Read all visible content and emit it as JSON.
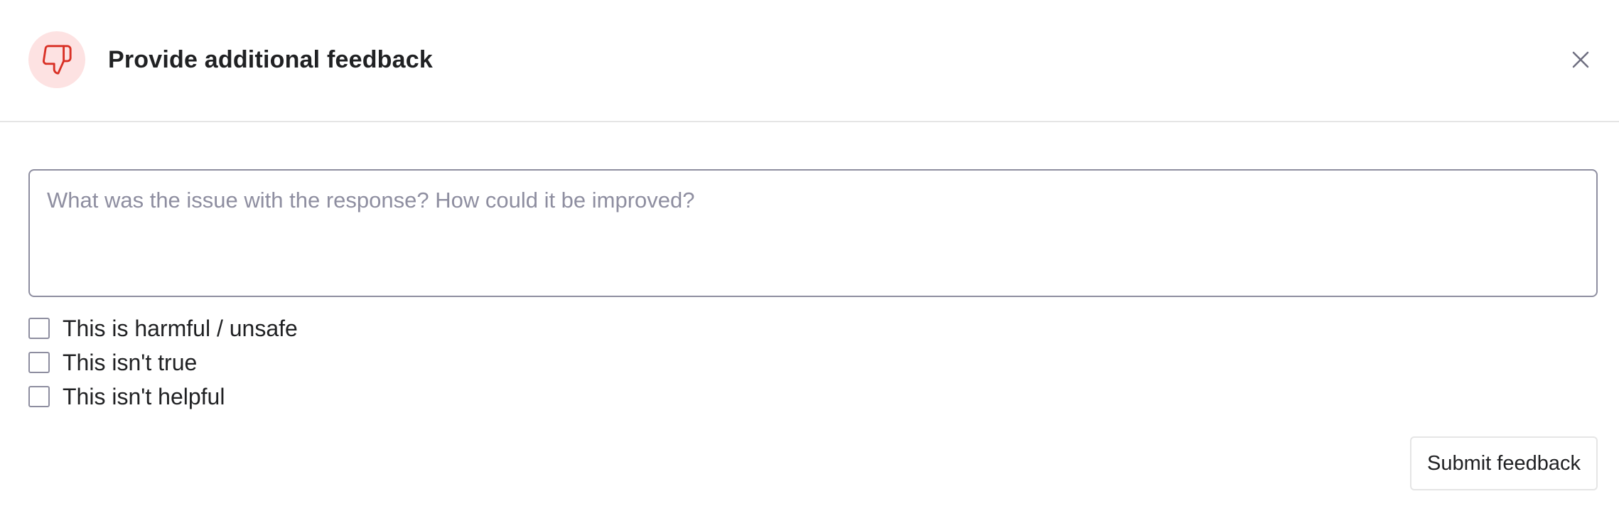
{
  "dialog": {
    "title": "Provide additional feedback",
    "header_icon": "thumbs-down-icon",
    "close_icon": "close-icon",
    "accent_color": "#d93025",
    "badge_color": "#fde2e2"
  },
  "feedback": {
    "placeholder": "What was the issue with the response? How could it be improved?",
    "value": ""
  },
  "options": [
    {
      "label": "This is harmful / unsafe",
      "checked": false
    },
    {
      "label": "This isn't true",
      "checked": false
    },
    {
      "label": "This isn't helpful",
      "checked": false
    }
  ],
  "actions": {
    "submit_label": "Submit feedback"
  }
}
